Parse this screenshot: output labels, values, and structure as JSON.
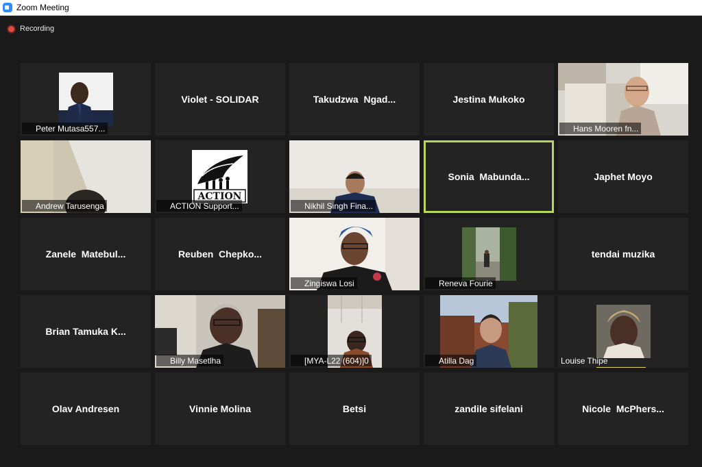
{
  "window": {
    "title": "Zoom Meeting",
    "icon": "zoom-app-icon"
  },
  "recording": {
    "label": "Recording",
    "indicator_color": "#e04a3f"
  },
  "muted_icon": "muted-microphone-icon",
  "muted_color": "#e02828",
  "active_speaker_border": "#b9d75a",
  "participants": [
    {
      "name": "Peter Mutasa557...",
      "display": ""
    },
    {
      "name": "",
      "display": "Violet - SOLIDAR"
    },
    {
      "name": "",
      "display": "Takudzwa  Ngad..."
    },
    {
      "name": "",
      "display": "Jestina Mukoko"
    },
    {
      "name": "Hans Mooren fn...",
      "display": ""
    },
    {
      "name": "Andrew Tarusenga",
      "display": ""
    },
    {
      "name": "ACTION Support...",
      "display": "",
      "logo_text": "ACTION"
    },
    {
      "name": "Nikhil Singh Fina...",
      "display": ""
    },
    {
      "name": "",
      "display": "Sonia  Mabunda..."
    },
    {
      "name": "",
      "display": "Japhet Moyo"
    },
    {
      "name": "",
      "display": "Zanele  Matebul..."
    },
    {
      "name": "",
      "display": "Reuben  Chepko..."
    },
    {
      "name": "Zingiswa Losi",
      "display": ""
    },
    {
      "name": "Reneva Fourie",
      "display": ""
    },
    {
      "name": "",
      "display": "tendai muzika"
    },
    {
      "name": "",
      "display": "Brian Tamuka K..."
    },
    {
      "name": "Billy Masetlha",
      "display": ""
    },
    {
      "name": "[MYA-L22 (604)]0",
      "display": ""
    },
    {
      "name": "Atilla Dag",
      "display": ""
    },
    {
      "name": "Louise Thipe",
      "display": ""
    },
    {
      "name": "",
      "display": "Olav Andresen"
    },
    {
      "name": "",
      "display": "Vinnie Molina"
    },
    {
      "name": "",
      "display": "Betsi"
    },
    {
      "name": "",
      "display": "zandile sifelani"
    },
    {
      "name": "",
      "display": "Nicole  McPhers..."
    }
  ]
}
